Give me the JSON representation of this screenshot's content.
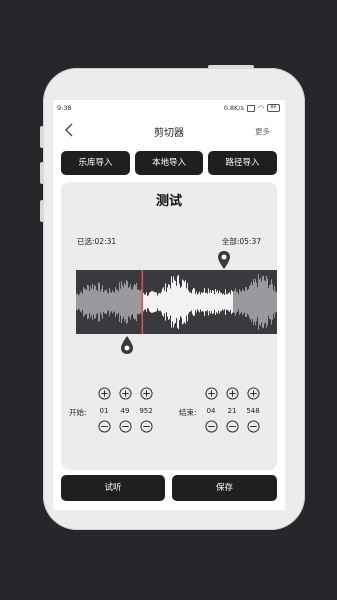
{
  "status": {
    "time": "9:38",
    "speed": "0.8K/s",
    "battery": "86"
  },
  "nav": {
    "title": "剪切器",
    "more": "更多"
  },
  "import_buttons": [
    "乐库导入",
    "本地导入",
    "路径导入"
  ],
  "song": {
    "title": "测试",
    "selected_label": "已选:02:31",
    "total_label": "全部:05:37",
    "selection_start_fraction": 0.33,
    "selection_end_fraction": 0.78
  },
  "start": {
    "label": "开始:",
    "min": "01",
    "sec": "49",
    "ms": "952"
  },
  "end": {
    "label": "结束:",
    "min": "04",
    "sec": "21",
    "ms": "548"
  },
  "actions": {
    "preview": "试听",
    "save": "保存"
  },
  "colors": {
    "background": "#27262b",
    "button": "#1f1f1f",
    "waveform_bg": "#3a3a3e",
    "selection_line": "#e05050"
  }
}
